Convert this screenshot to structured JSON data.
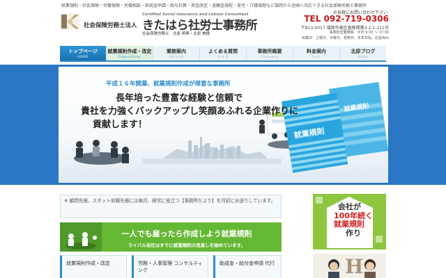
{
  "header": {
    "tagline": "就業規則・社会保険・労働保険・労働相談・助成金申請・給与計算・賃金改定・退職金規程・育児・介護規程など福岡から全国へ対応できる社会保険労務士事務所",
    "corp_type": "社会保険労務士法人",
    "english_name": "Certified Social Insurance and Labour Consultant",
    "office_name": "きたはら社労士事務所",
    "names": "社会保険労務士　北原 明典・北原 美穂",
    "inquiry_label": "お気軽にお問い合わせ下さい",
    "tel": "TEL 092-719-0306",
    "address": "〒813-0017 福岡市東区香椎照葉3-2-1-211号",
    "hours": "事務所営業時間：平日 9:30 ～ 17:30",
    "holidays": "休業日：土曜日、日曜日、祝祭日、年末年始、お盆休み"
  },
  "nav": {
    "items": [
      {
        "label": "トップページ",
        "sub": "HOME"
      },
      {
        "label": "就業規則作成・改定",
        "sub": "Regulations"
      },
      {
        "label": "業務案内",
        "sub": "Service"
      },
      {
        "label": "よくある質問",
        "sub": "Q & A"
      },
      {
        "label": "事務所概要",
        "sub": "Company"
      },
      {
        "label": "料金案内",
        "sub": "Fees"
      },
      {
        "label": "北原ブログ",
        "sub": "Blogs"
      }
    ]
  },
  "hero": {
    "tag": "平成１６年開業、就業規則作成が得意な事務所",
    "line1": "長年培った豊富な経験と信頼で",
    "line2": "貴社を力強くバックアップし笑顔あふれる企業作りに",
    "line3": "貢献します！",
    "book_label_1": "就業規則",
    "book_label_2": "就業規則"
  },
  "content": {
    "notice": "※ 顧問先様、スポット依頼先様には毎月、経営に役立つ【事務所だより】を月初にお送りしています。",
    "banner_main": "一人でも雇ったら作成しよう就業規則",
    "banner_sub": "ライバル会社はすでに就業規則の見直しを始めています。",
    "box1": "就業規則作成・改定",
    "box2": "労務・人事管理 コンサルティング",
    "box3": "助成金・給付金申請 代行"
  },
  "sidebar": {
    "ad_line1": "会社が",
    "ad_line2": "100年続く",
    "ad_line3": "就業規則",
    "ad_line4": "作り",
    "photo_mark": "H"
  },
  "colors": {
    "accent_blue": "#2c8cc8",
    "hero_blue": "#2b76c4",
    "tel_red": "#c8191f",
    "banner_green": "#65b833"
  }
}
